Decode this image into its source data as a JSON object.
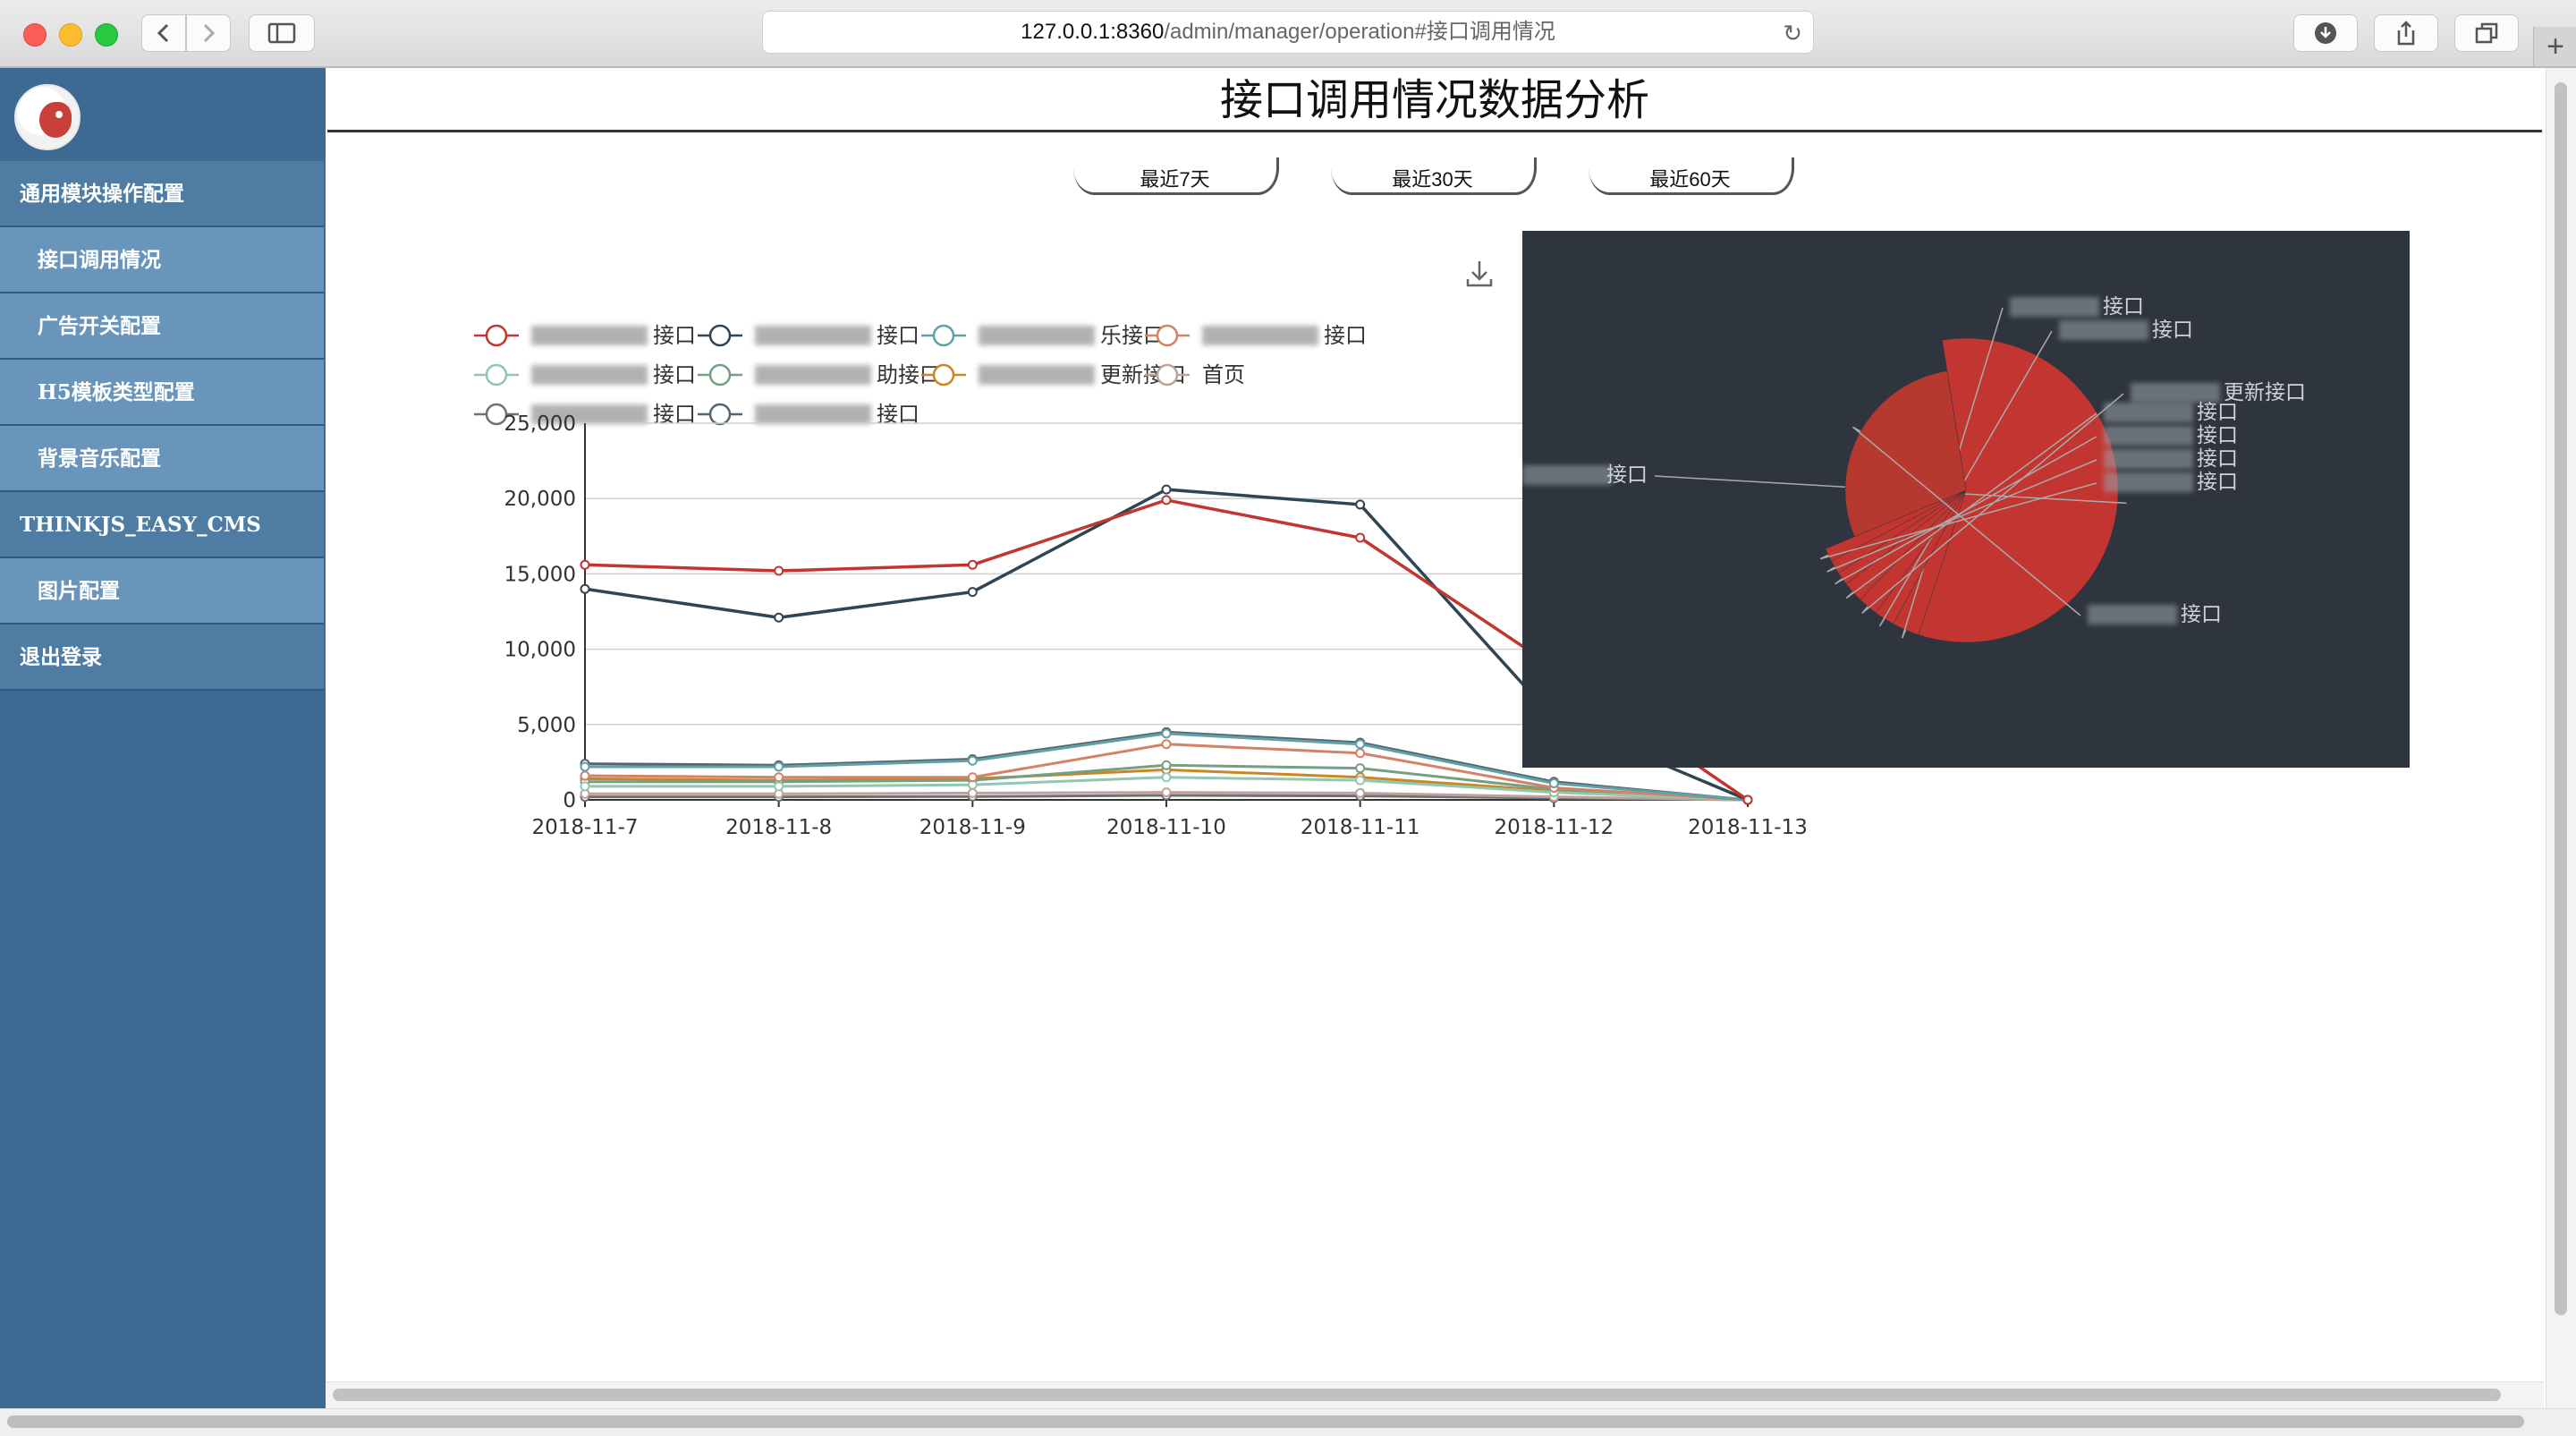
{
  "browser": {
    "url_host": "127.0.0.1:8360",
    "url_path": "/admin/manager/operation#接口调用情况"
  },
  "sidebar": {
    "items": [
      {
        "label": "通用模块操作配置",
        "type": "group"
      },
      {
        "label": "接口调用情况",
        "type": "sub"
      },
      {
        "label": "广告开关配置",
        "type": "sub"
      },
      {
        "label": "H5模板类型配置",
        "type": "sub"
      },
      {
        "label": "背景音乐配置",
        "type": "sub"
      },
      {
        "label": "THINKJS_EASY_CMS",
        "type": "group"
      },
      {
        "label": "图片配置",
        "type": "sub"
      },
      {
        "label": "退出登录",
        "type": "group"
      }
    ]
  },
  "main": {
    "title": "接口调用情况数据分析",
    "range_buttons": [
      "最近7天",
      "最近30天",
      "最近60天"
    ]
  },
  "colors": {
    "sidebar_bg": "#3d6a93",
    "pie_bg": "#2f353f",
    "series_red": "#c23531",
    "series_dark": "#2f4554"
  },
  "chart_data": [
    {
      "type": "line",
      "categories": [
        "2018-11-7",
        "2018-11-8",
        "2018-11-9",
        "2018-11-10",
        "2018-11-11",
        "2018-11-12",
        "2018-11-13"
      ],
      "ylim": [
        0,
        25000
      ],
      "yticks": [
        "0",
        "5,000",
        "10,000",
        "15,000",
        "20,000",
        "25,000"
      ],
      "grid": true,
      "legend_position": "top",
      "legend": [
        {
          "label": "接口",
          "color": "#c23531",
          "blurred": true
        },
        {
          "label": "接口",
          "color": "#2f4554",
          "blurred": true
        },
        {
          "label": "乐接口",
          "color": "#61a0a8",
          "blurred": true
        },
        {
          "label": "接口",
          "color": "#d48265",
          "blurred": true
        },
        {
          "label": "接口",
          "color": "#91c7ae",
          "blurred": true
        },
        {
          "label": "助接口",
          "color": "#749f83",
          "blurred": true
        },
        {
          "label": "更新接口",
          "color": "#ca8622",
          "blurred": true
        },
        {
          "label": "首页",
          "color": "#bda29a",
          "blurred": false
        },
        {
          "label": "接口",
          "color": "#6e7074",
          "blurred": true
        },
        {
          "label": "接口",
          "color": "#546570",
          "blurred": true
        }
      ],
      "series": [
        {
          "color": "#c23531",
          "values": [
            15600,
            15200,
            15600,
            19900,
            17400,
            8800,
            0
          ]
        },
        {
          "color": "#2f4554",
          "values": [
            14000,
            12100,
            13800,
            20600,
            19600,
            5400,
            0
          ]
        },
        {
          "color": "#61a0a8",
          "values": [
            2200,
            2200,
            2600,
            4400,
            3700,
            1100,
            0
          ]
        },
        {
          "color": "#d48265",
          "values": [
            1600,
            1500,
            1500,
            3700,
            3100,
            800,
            0
          ]
        },
        {
          "color": "#91c7ae",
          "values": [
            900,
            900,
            1000,
            1500,
            1300,
            500,
            0
          ]
        },
        {
          "color": "#749f83",
          "values": [
            1200,
            1200,
            1300,
            2300,
            2100,
            700,
            0
          ]
        },
        {
          "color": "#ca8622",
          "values": [
            1400,
            1300,
            1400,
            2000,
            1500,
            600,
            0
          ]
        },
        {
          "color": "#bda29a",
          "values": [
            400,
            400,
            450,
            500,
            450,
            200,
            0
          ]
        },
        {
          "color": "#6e7074",
          "values": [
            200,
            200,
            220,
            300,
            260,
            120,
            0
          ]
        },
        {
          "color": "#546570",
          "values": [
            2400,
            2300,
            2700,
            4500,
            3800,
            1200,
            0
          ]
        }
      ]
    },
    {
      "type": "pie",
      "background": "#2f353f",
      "labels": [
        "接口",
        "接口",
        "接口",
        "更新接口",
        "接口",
        "接口",
        "接口",
        "接口",
        "接口"
      ],
      "values": [
        8,
        0.4,
        0.3,
        0.3,
        0.3,
        0.2,
        0.2,
        0.2,
        4
      ]
    }
  ]
}
